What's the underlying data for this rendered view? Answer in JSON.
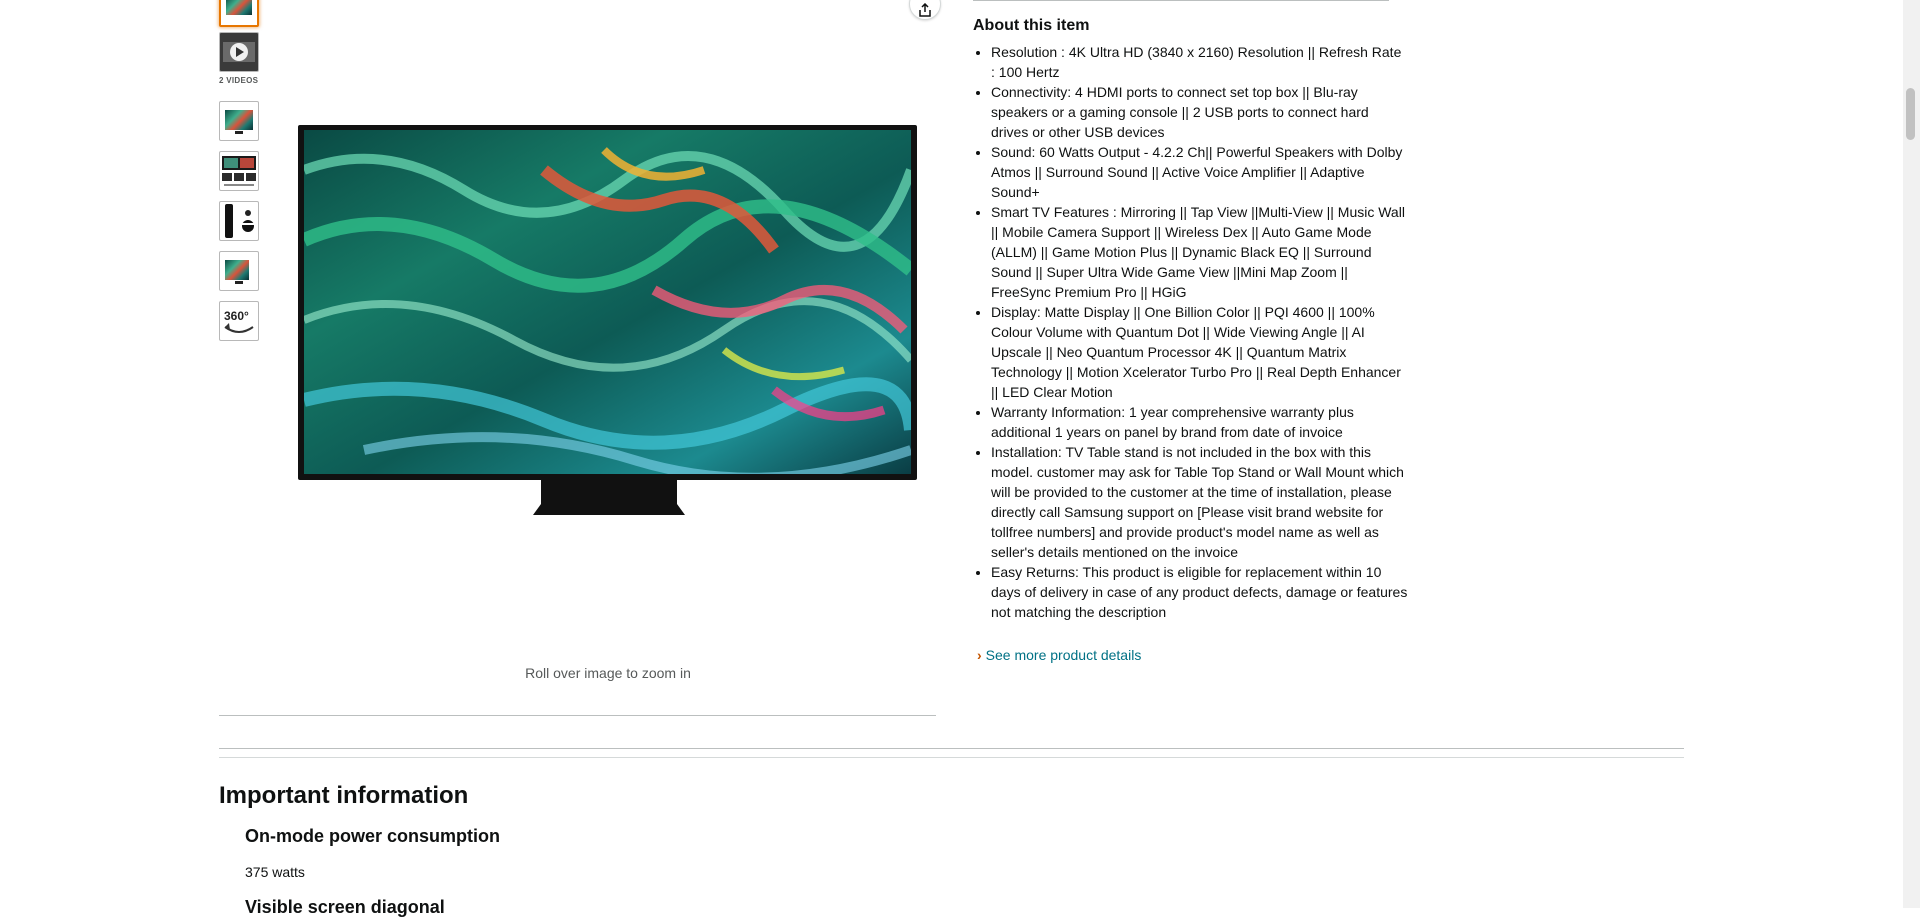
{
  "gallery": {
    "videos_label": "2 VIDEOS",
    "thumbnails": [
      "tv-front-thumbnail",
      "video-thumbnail",
      "tv-front-thumbnail",
      "tv-features-thumbnail",
      "remote-thumbnail",
      "tv-soundbar-thumbnail",
      "360-view-thumbnail"
    ],
    "view360_label": "360°",
    "active_index": 0
  },
  "main_image": {
    "zoom_hint": "Roll over image to zoom in"
  },
  "about": {
    "title": "About this item",
    "bullets": [
      "Resolution : 4K Ultra HD (3840 x 2160) Resolution || Refresh Rate : 100 Hertz",
      "Connectivity: 4 HDMI ports to connect set top box || Blu-ray speakers or a gaming console || 2 USB ports to connect hard drives or other USB devices",
      "Sound: 60 Watts Output - 4.2.2 Ch|| Powerful Speakers with Dolby Atmos || Surround Sound || Active Voice Amplifier || Adaptive Sound+",
      "Smart TV Features : Mirroring || Tap View ||Multi-View || Music Wall || Mobile Camera Support || Wireless Dex || Auto Game Mode (ALLM) || Game Motion Plus || Dynamic Black EQ || Surround Sound || Super Ultra Wide Game View ||Mini Map Zoom || FreeSync Premium Pro || HGiG",
      "Display: Matte Display || One Billion Color || PQI 4600 || 100% Colour Volume with Quantum Dot || Wide Viewing Angle || AI Upscale || Neo Quantum Processor 4K || Quantum Matrix Technology || Motion Xcelerator Turbo Pro || Real Depth Enhancer || LED Clear Motion",
      "Warranty Information: 1 year comprehensive warranty plus additional 1 years on panel by brand from date of invoice",
      "Installation: TV Table stand is not included in the box with this model. customer may ask for Table Top Stand or Wall Mount which will be provided to the customer at the time of installation, please directly call Samsung support on [Please visit brand website for tollfree numbers] and provide product's model name as well as seller's details mentioned on the invoice",
      "Easy Returns: This product is eligible for replacement within 10 days of delivery in case of any product defects, damage or features not matching the description"
    ],
    "see_more": "See more product details",
    "see_more_chevron": "›"
  },
  "important_info": {
    "title": "Important information",
    "power_title": "On-mode power consumption",
    "power_value": "375 watts",
    "next_title": "Visible screen diagonal"
  },
  "colors": {
    "link": "#007185",
    "chevron": "#c45500",
    "active_thumb_border": "#e77600",
    "text": "#0f1111",
    "muted": "#565959"
  }
}
